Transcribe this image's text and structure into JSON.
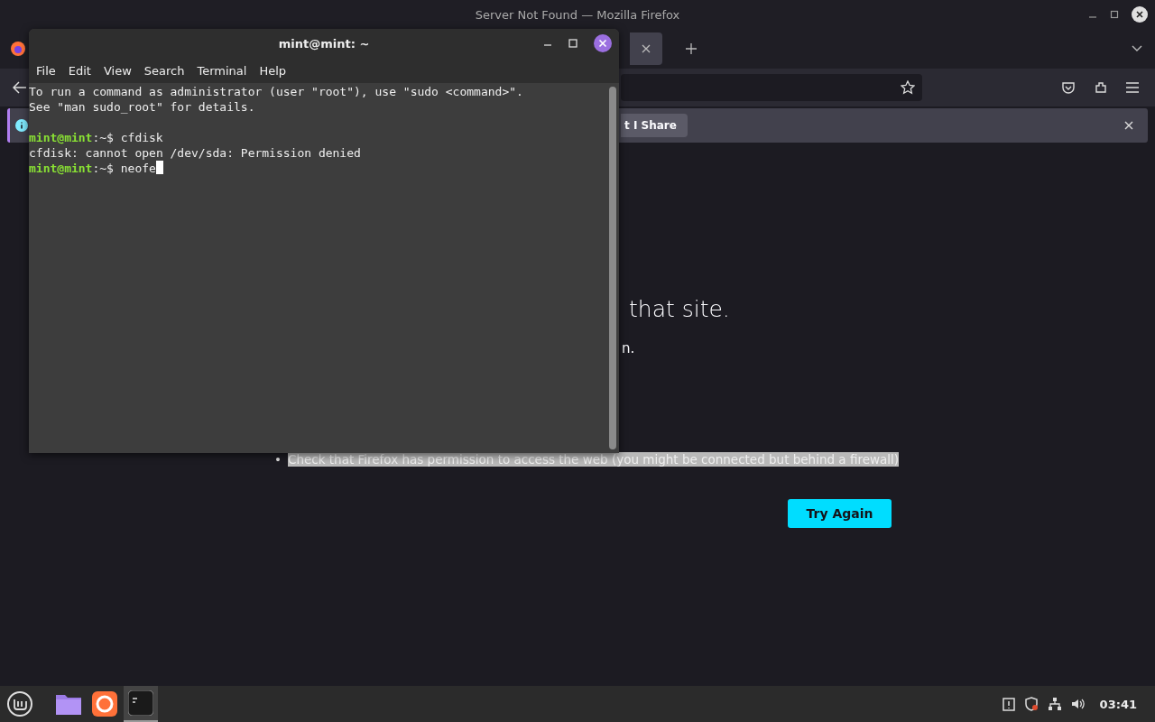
{
  "firefox": {
    "title": "Server Not Found — Mozilla Firefox",
    "notification": {
      "button": "t I Share"
    },
    "page": {
      "heading": "that site.",
      "text": "n.",
      "bullets": [
        {
          "bullet": "•",
          "text": "Check that Firefox has permission to access the web (you might be connected but behind a firewall)",
          "selected": true
        }
      ],
      "button": "Try Again"
    }
  },
  "terminal": {
    "title": "mint@mint: ~",
    "menu": [
      "File",
      "Edit",
      "View",
      "Search",
      "Terminal",
      "Help"
    ],
    "lines": [
      {
        "kind": "output",
        "text": "To run a command as administrator (user \"root\"), use \"sudo <command>\"."
      },
      {
        "kind": "output",
        "text": "See \"man sudo_root\" for details."
      },
      {
        "kind": "blank"
      },
      {
        "kind": "prompt",
        "user": "mint@mint",
        "path": ":~$",
        "command": "cfdisk",
        "cursor": false
      },
      {
        "kind": "output",
        "text": "cfdisk: cannot open /dev/sda: Permission denied"
      },
      {
        "kind": "prompt",
        "user": "mint@mint",
        "path": ":~$",
        "command": "neofe",
        "cursor": true
      }
    ]
  },
  "taskbar": {
    "apps": [
      {
        "kind": "files",
        "selected": false
      },
      {
        "kind": "firefox",
        "selected": false
      },
      {
        "kind": "terminal",
        "selected": true
      }
    ],
    "clock": "03:41"
  }
}
